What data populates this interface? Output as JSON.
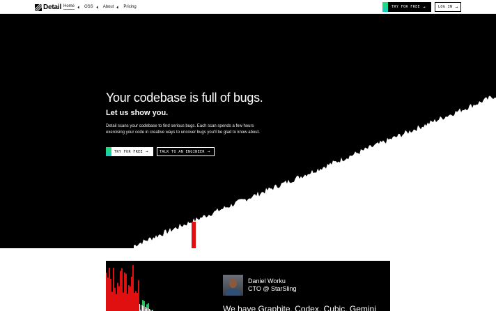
{
  "nav": {
    "logo_text": "Detail",
    "links": [
      {
        "label": "Home",
        "active": true
      },
      {
        "label": "OSS",
        "active": false
      },
      {
        "label": "About",
        "active": false
      },
      {
        "label": "Pricing",
        "active": false
      }
    ],
    "try_label": "TRY FOR FREE",
    "login_label": "LOG IN",
    "arrow_glyph": "→"
  },
  "hero": {
    "title": "Your codebase is full of bugs.",
    "subtitle": "Let us show you.",
    "description": "Detail scans your codebase to find serious bugs. Each scan spends a few hours exercising your code in creative ways to uncover bugs you'll be glad to know about.",
    "try_label": "TRY FOR FREE",
    "talk_label": "TALK TO AN ENGINEER",
    "arrow_glyph": "→"
  },
  "testimonial": {
    "name": "Daniel Worku",
    "role": "CTO @ StarSling",
    "quote": "We have Graphite, Codex, Cubic, Gemini"
  },
  "colors": {
    "accent_green": "#22c55e",
    "bar_red": "#e01010",
    "background": "#000000"
  }
}
